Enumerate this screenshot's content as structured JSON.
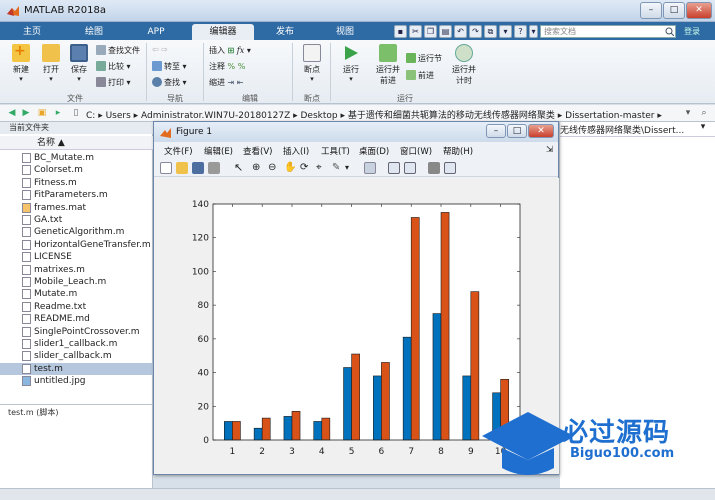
{
  "window": {
    "title": "MATLAB R2018a"
  },
  "tabs": [
    "主页",
    "绘图",
    "APP",
    "编辑器",
    "发布",
    "视图"
  ],
  "active_tab": "编辑器",
  "search": {
    "placeholder": "搜索文档"
  },
  "login": "登录",
  "ribbon": {
    "new": "新建",
    "open": "打开",
    "save": "保存",
    "find_files": "查找文件",
    "compare": "比较",
    "print": "打印",
    "goto": "转至",
    "find": "查找",
    "insert": "插入",
    "comment": "注释",
    "indent": "缩进",
    "breakpoints": "断点",
    "run": "运行",
    "run_advance": "运行并\n前进",
    "run_section": "运行节",
    "advance": "前进",
    "run_time": "运行并\n计时",
    "groups": {
      "file": "文件",
      "navigate": "导航",
      "edit": "编辑",
      "breakpoints": "断点",
      "run": "运行"
    }
  },
  "address": {
    "path": [
      "C:",
      "Users",
      "Administrator.WIN7U-20180127Z",
      "Desktop",
      "基于遗传和细菌共轭算法的移动无线传感器网络聚类",
      "Dissertation-master"
    ]
  },
  "current_folder": {
    "header": "当前文件夹",
    "column": "名称 ▲"
  },
  "files": [
    {
      "name": "BC_Mutate.m",
      "type": "m"
    },
    {
      "name": "Colorset.m",
      "type": "m"
    },
    {
      "name": "Fitness.m",
      "type": "m"
    },
    {
      "name": "FitParameters.m",
      "type": "m"
    },
    {
      "name": "frames.mat",
      "type": "mat"
    },
    {
      "name": "GA.txt",
      "type": "txt"
    },
    {
      "name": "GeneticAlgorithm.m",
      "type": "m"
    },
    {
      "name": "HorizontalGeneTransfer.m",
      "type": "m"
    },
    {
      "name": "LICENSE",
      "type": "txt"
    },
    {
      "name": "matrixes.m",
      "type": "m"
    },
    {
      "name": "Mobile_Leach.m",
      "type": "m"
    },
    {
      "name": "Mutate.m",
      "type": "m"
    },
    {
      "name": "Readme.txt",
      "type": "txt"
    },
    {
      "name": "README.md",
      "type": "txt"
    },
    {
      "name": "SinglePointCrossover.m",
      "type": "m"
    },
    {
      "name": "slider1_callback.m",
      "type": "m"
    },
    {
      "name": "slider_callback.m",
      "type": "m"
    },
    {
      "name": "test.m",
      "type": "m",
      "selected": true
    },
    {
      "name": "untitled.jpg",
      "type": "img"
    }
  ],
  "details": {
    "label": "test.m (脚本)"
  },
  "right_crumb": "无线传感器网络聚类\\Dissert...",
  "figure": {
    "title": "Figure 1",
    "menu": [
      "文件(F)",
      "编辑(E)",
      "查看(V)",
      "插入(I)",
      "工具(T)",
      "桌面(D)",
      "窗口(W)",
      "帮助(H)"
    ]
  },
  "watermark": {
    "text": "必过源码",
    "url": "Biguo100.com"
  },
  "colors": {
    "series1": "#0072BD",
    "series2": "#D95319",
    "accent": "#2e6aa3"
  },
  "chart_data": {
    "type": "bar",
    "categories": [
      "1",
      "2",
      "3",
      "4",
      "5",
      "6",
      "7",
      "8",
      "9",
      "10"
    ],
    "series": [
      {
        "values": [
          11,
          7,
          14,
          11,
          43,
          38,
          61,
          75,
          38,
          28
        ]
      },
      {
        "values": [
          11,
          13,
          17,
          13,
          51,
          46,
          132,
          135,
          88,
          36
        ]
      }
    ],
    "ylim": [
      0,
      140
    ],
    "yticks": [
      0,
      20,
      40,
      60,
      80,
      100,
      120,
      140
    ],
    "grid": false
  }
}
